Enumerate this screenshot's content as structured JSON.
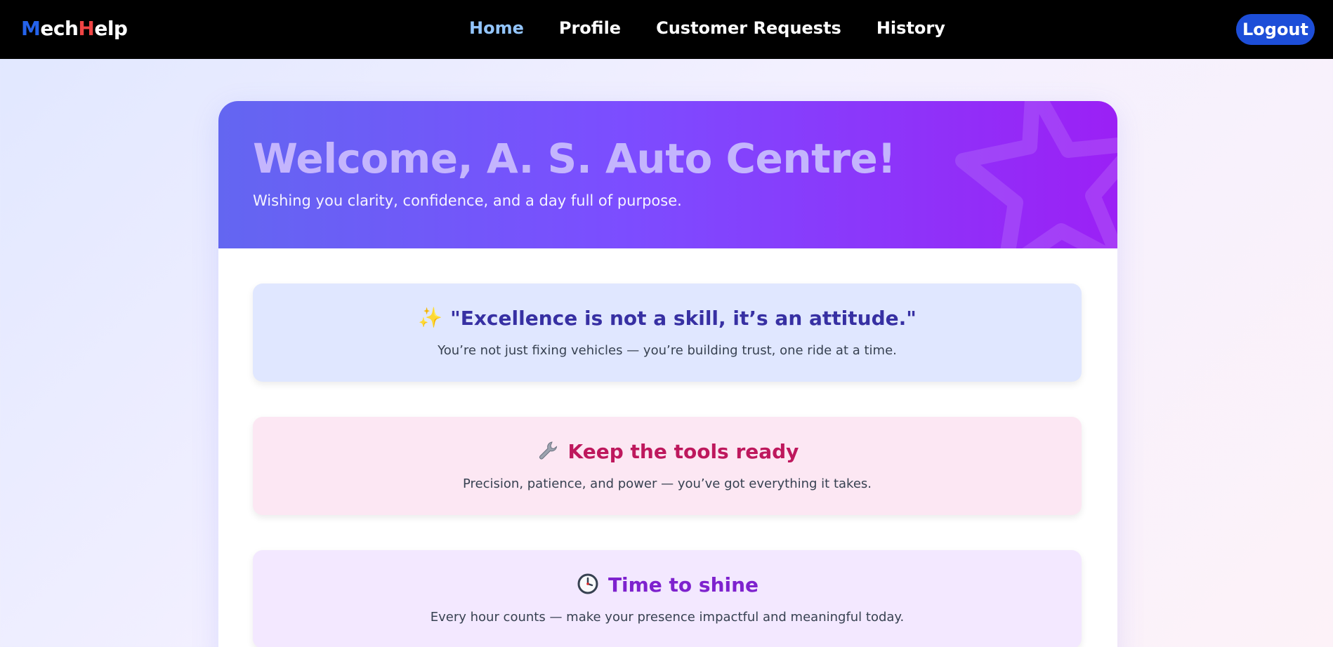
{
  "navbar": {
    "brand_m": "M",
    "brand_ech": "ech",
    "brand_h": "H",
    "brand_elp": "elp",
    "links": [
      "Home",
      "Profile",
      "Customer Requests",
      "History"
    ],
    "logout_label": "Logout"
  },
  "hero": {
    "title": "Welcome, A. S. Auto Centre!",
    "subtitle": "Wishing you clarity, confidence, and a day full of purpose."
  },
  "cards": [
    {
      "icon": "sparkles-icon",
      "title": "\"Excellence is not a skill, it’s an attitude.\"",
      "text": "You’re not just fixing vehicles — you’re building trust, one ride at a time."
    },
    {
      "icon": "wrench-icon",
      "title": "Keep the tools ready",
      "text": "Precision, patience, and power — you’ve got everything it takes."
    },
    {
      "icon": "clock-icon",
      "title": "Time to shine",
      "text": "Every hour counts — make your presence impactful and meaningful today."
    }
  ],
  "colors": {
    "accent": "#1d4ed8",
    "nav_active": "#93c5fd",
    "hero_gradient_start": "#6366f1",
    "hero_gradient_end": "#9b20f5"
  }
}
